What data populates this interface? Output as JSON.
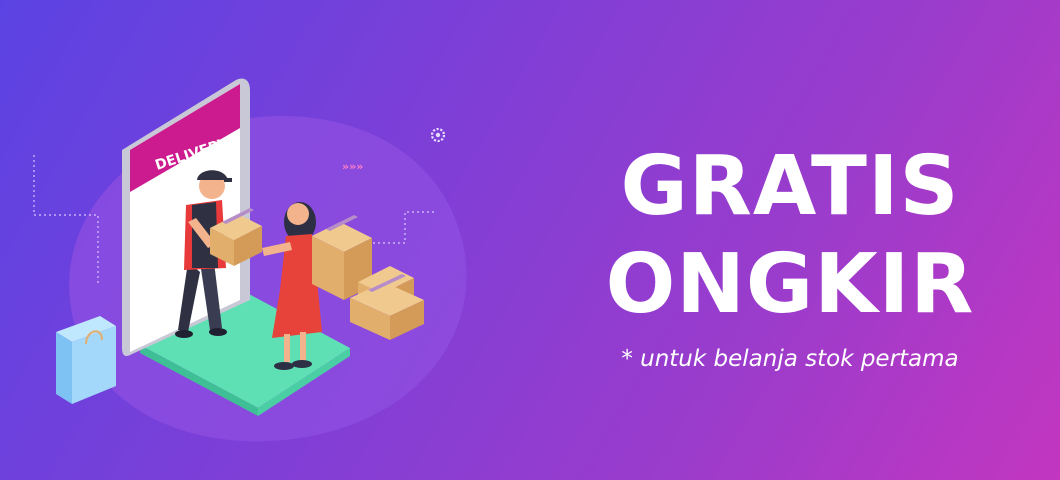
{
  "banner": {
    "headline_line1": "GRATIS",
    "headline_line2": "ONGKIR",
    "note": "* untuk belanja stok pertama"
  },
  "illustration": {
    "phone_label": "DELIVERY",
    "decorations": [
      "gear-icon",
      "chevrons-icon",
      "shopping-bag-icon"
    ]
  },
  "colors": {
    "gradient_start": "#5b43e3",
    "gradient_end": "#c236c0",
    "phone_header": "#cc1a8f",
    "platform": "#5fe0b4",
    "box": "#e8b878",
    "tape": "#b68cc9"
  }
}
